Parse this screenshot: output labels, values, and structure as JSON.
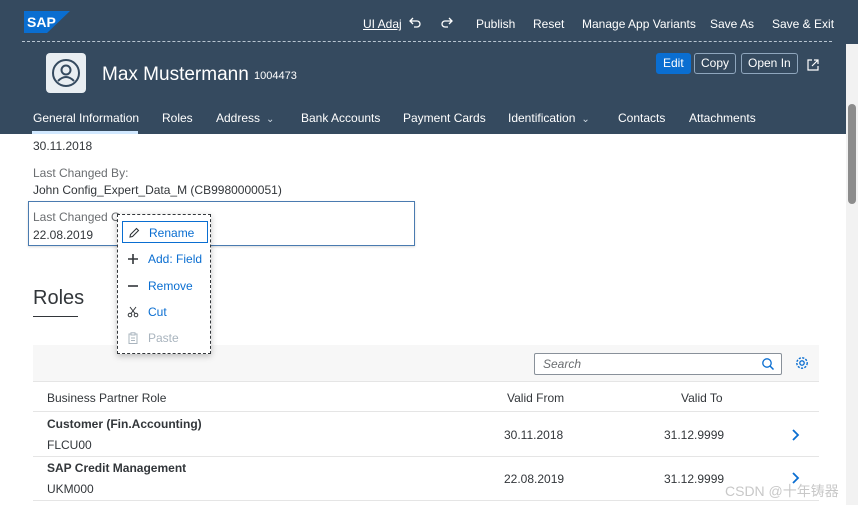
{
  "shell": {
    "logo_text": "SAP",
    "ui_adapt": "UI Adaj",
    "publish": "Publish",
    "reset": "Reset",
    "manage_variants": "Manage App Variants",
    "save_as": "Save As",
    "save_exit": "Save & Exit"
  },
  "header": {
    "name": "Max Mustermann",
    "id": "1004473",
    "buttons": {
      "edit": "Edit",
      "copy": "Copy",
      "open_in": "Open In"
    }
  },
  "tabs": [
    {
      "label": "General Information"
    },
    {
      "label": "Roles"
    },
    {
      "label": "Address",
      "chevron": "⌄"
    },
    {
      "label": "Bank Accounts"
    },
    {
      "label": "Payment Cards"
    },
    {
      "label": "Identification",
      "chevron": "⌄"
    },
    {
      "label": "Contacts"
    },
    {
      "label": "Attachments"
    }
  ],
  "general": {
    "date_value": "30.11.2018",
    "last_changed_by_label": "Last Changed By:",
    "last_changed_by_value": "John Config_Expert_Data_M (CB9980000051)",
    "last_changed_on_label": "Last Changed O",
    "last_changed_on_value": "22.08.2019"
  },
  "context_menu": {
    "items": [
      {
        "label": "Rename",
        "icon": "pencil-icon",
        "state": "active"
      },
      {
        "label": "Add: Field",
        "icon": "plus-icon",
        "state": "enabled"
      },
      {
        "label": "Remove",
        "icon": "minus-icon",
        "state": "enabled"
      },
      {
        "label": "Cut",
        "icon": "scissors-icon",
        "state": "enabled"
      },
      {
        "label": "Paste",
        "icon": "paste-icon",
        "state": "disabled"
      }
    ]
  },
  "roles": {
    "title": "Roles",
    "search_placeholder": "Search",
    "columns": {
      "role": "Business Partner Role",
      "valid_from": "Valid From",
      "valid_to": "Valid To"
    },
    "rows": [
      {
        "title": "Customer (Fin.Accounting)",
        "code": "FLCU00",
        "valid_from": "30.11.2018",
        "valid_to": "31.12.9999"
      },
      {
        "title": "SAP Credit Management",
        "code": "UKM000",
        "valid_from": "22.08.2019",
        "valid_to": "31.12.9999"
      }
    ]
  },
  "watermark": "CSDN @十年铸器",
  "colors": {
    "shell": "#354a5f",
    "accent": "#0a6ed1",
    "text": "#32363a"
  }
}
